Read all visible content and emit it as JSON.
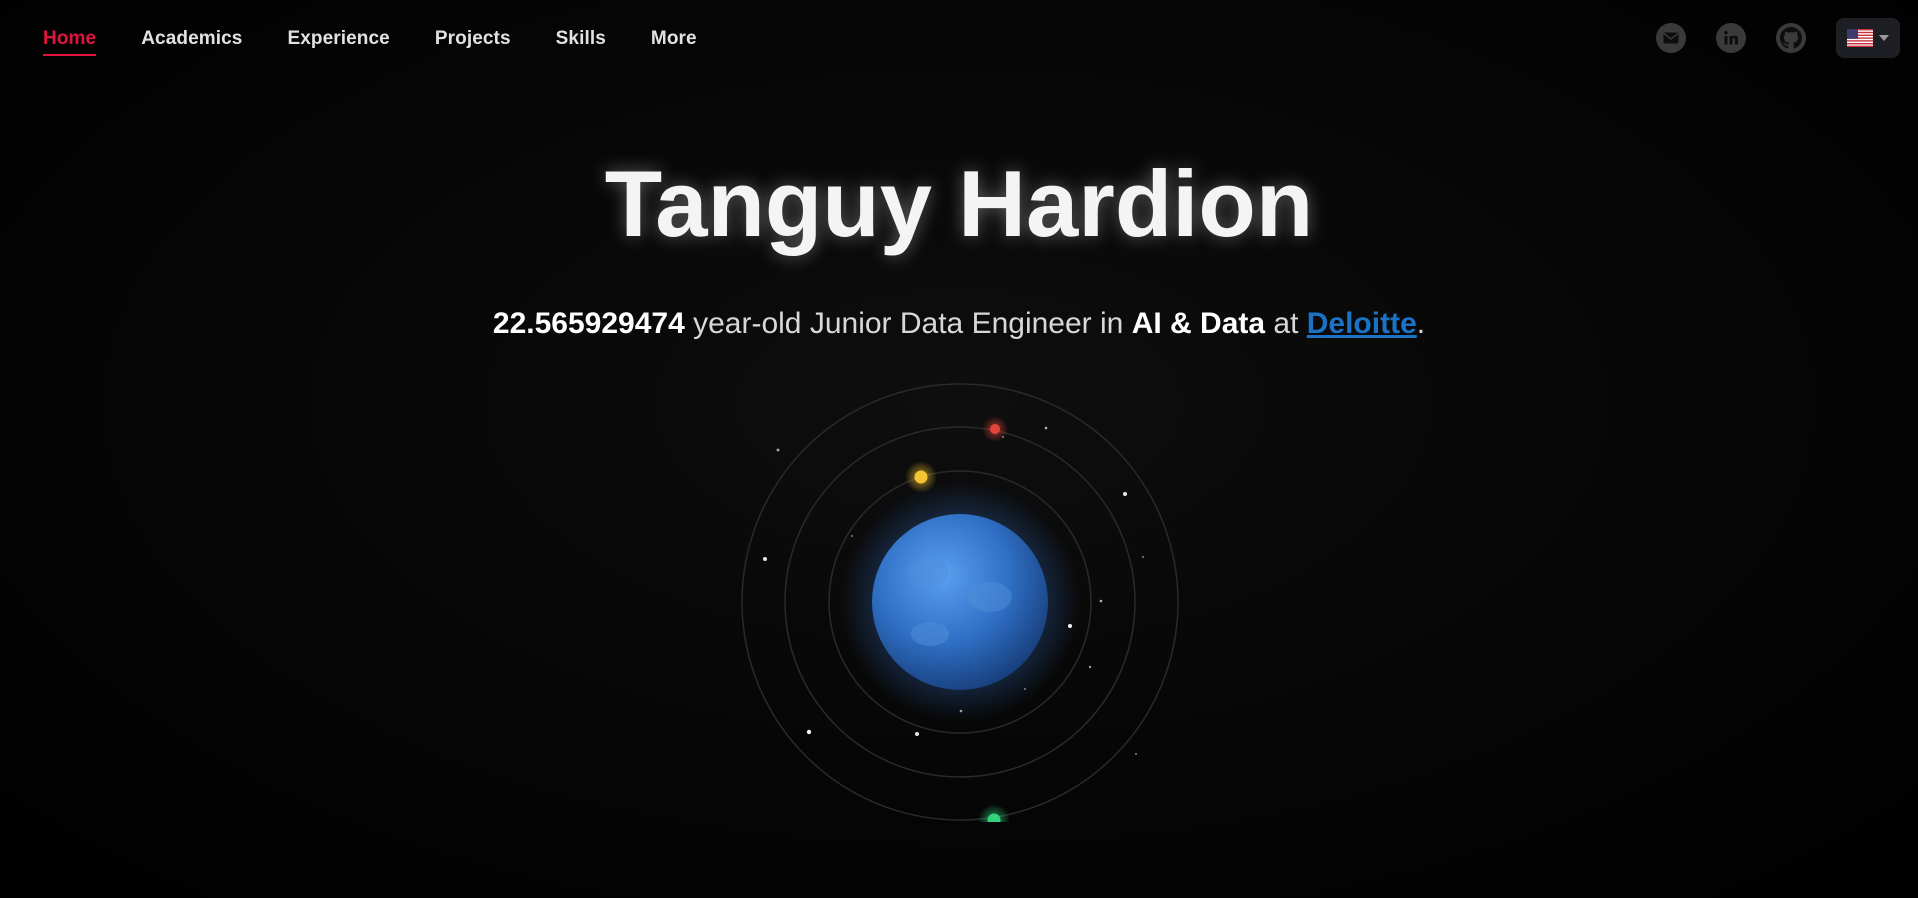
{
  "nav": {
    "links": [
      {
        "label": "Home",
        "active": true
      },
      {
        "label": "Academics"
      },
      {
        "label": "Experience"
      },
      {
        "label": "Projects"
      },
      {
        "label": "Skills"
      },
      {
        "label": "More"
      }
    ],
    "icons": [
      "mail-icon",
      "linkedin-icon",
      "github-icon"
    ],
    "language_flag": "us-flag-icon"
  },
  "hero": {
    "name": "Tanguy Hardion",
    "age": "22.565929474",
    "text_1": " year-old Junior Data Engineer in ",
    "field": "AI & Data",
    "text_2": " at ",
    "company": "Deloitte",
    "text_3": "."
  },
  "colors": {
    "accent": "#e0153f",
    "company_link": "#1a73c4",
    "planet": "#3a7fd6",
    "moon_red": "#e2463a",
    "moon_yellow": "#f4c431",
    "moon_green": "#32d37a"
  }
}
